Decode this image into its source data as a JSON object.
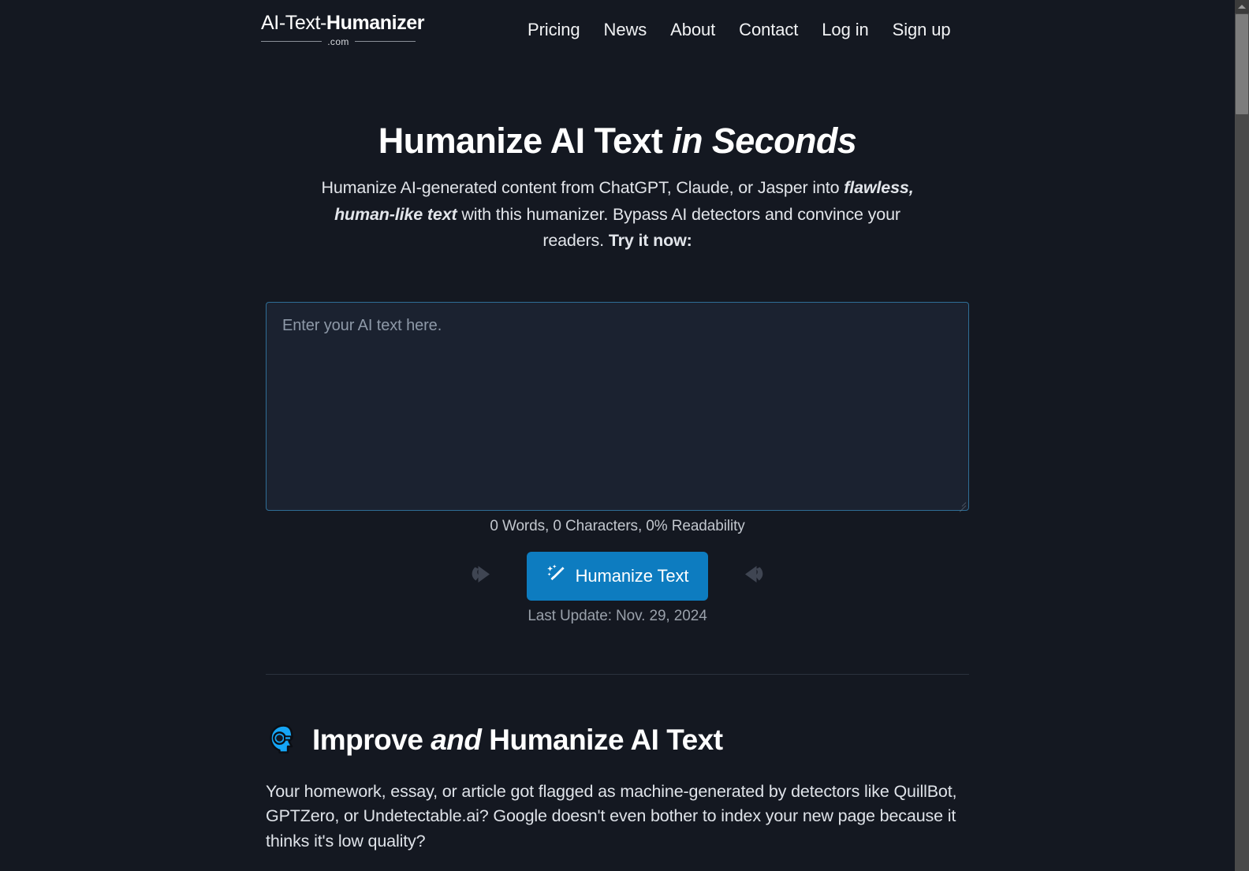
{
  "header": {
    "logo": {
      "main_regular": "AI-Text-",
      "main_bold": "Humanizer",
      "sub": ".com"
    },
    "nav": [
      {
        "label": "Pricing"
      },
      {
        "label": "News"
      },
      {
        "label": "About"
      },
      {
        "label": "Contact"
      },
      {
        "label": "Log in"
      },
      {
        "label": "Sign up"
      }
    ]
  },
  "hero": {
    "title_plain": "Humanize AI Text ",
    "title_italic": "in Seconds",
    "sub_1": "Humanize AI-generated content from ChatGPT, Claude, or Jasper into ",
    "sub_em_1": "flawless, human-like text",
    "sub_2": " with this humanizer. Bypass AI detectors and convince your readers. ",
    "sub_em_2": "Try it now:"
  },
  "editor": {
    "placeholder": "Enter your AI text here.",
    "value": "",
    "stats": "0 Words, 0 Characters, 0% Readability",
    "words": 0,
    "characters": 0,
    "readability_percent": 0
  },
  "actions": {
    "redo_icon": "redo-arrow-icon",
    "undo_icon": "undo-arrow-icon",
    "humanize_label": "Humanize Text",
    "humanize_icon": "magic-wand-icon",
    "last_update": "Last Update: Nov. 29, 2024"
  },
  "improve": {
    "icon": "ai-head-profile-icon",
    "title_1": "Improve ",
    "title_italic": "and",
    "title_2": " Humanize AI Text",
    "body": "Your homework, essay, or article got flagged as machine-generated by detectors like QuillBot, GPTZero, or Undetectable.ai? Google doesn't even bother to index your new page because it thinks it's low quality?"
  },
  "scrollbar": {
    "up_arrow_icon": "scroll-up-arrow-icon"
  },
  "colors": {
    "page_background": "#141821",
    "accent_blue": "#0d7cc0",
    "textarea_border": "#2f6e96",
    "textarea_fill": "#1b2230",
    "head_icon_cyan": "#16a5f5",
    "arrow_grey": "#3f4552",
    "scrollbar_track": "#4a4a4a",
    "scrollbar_thumb": "#7d7d7d"
  }
}
